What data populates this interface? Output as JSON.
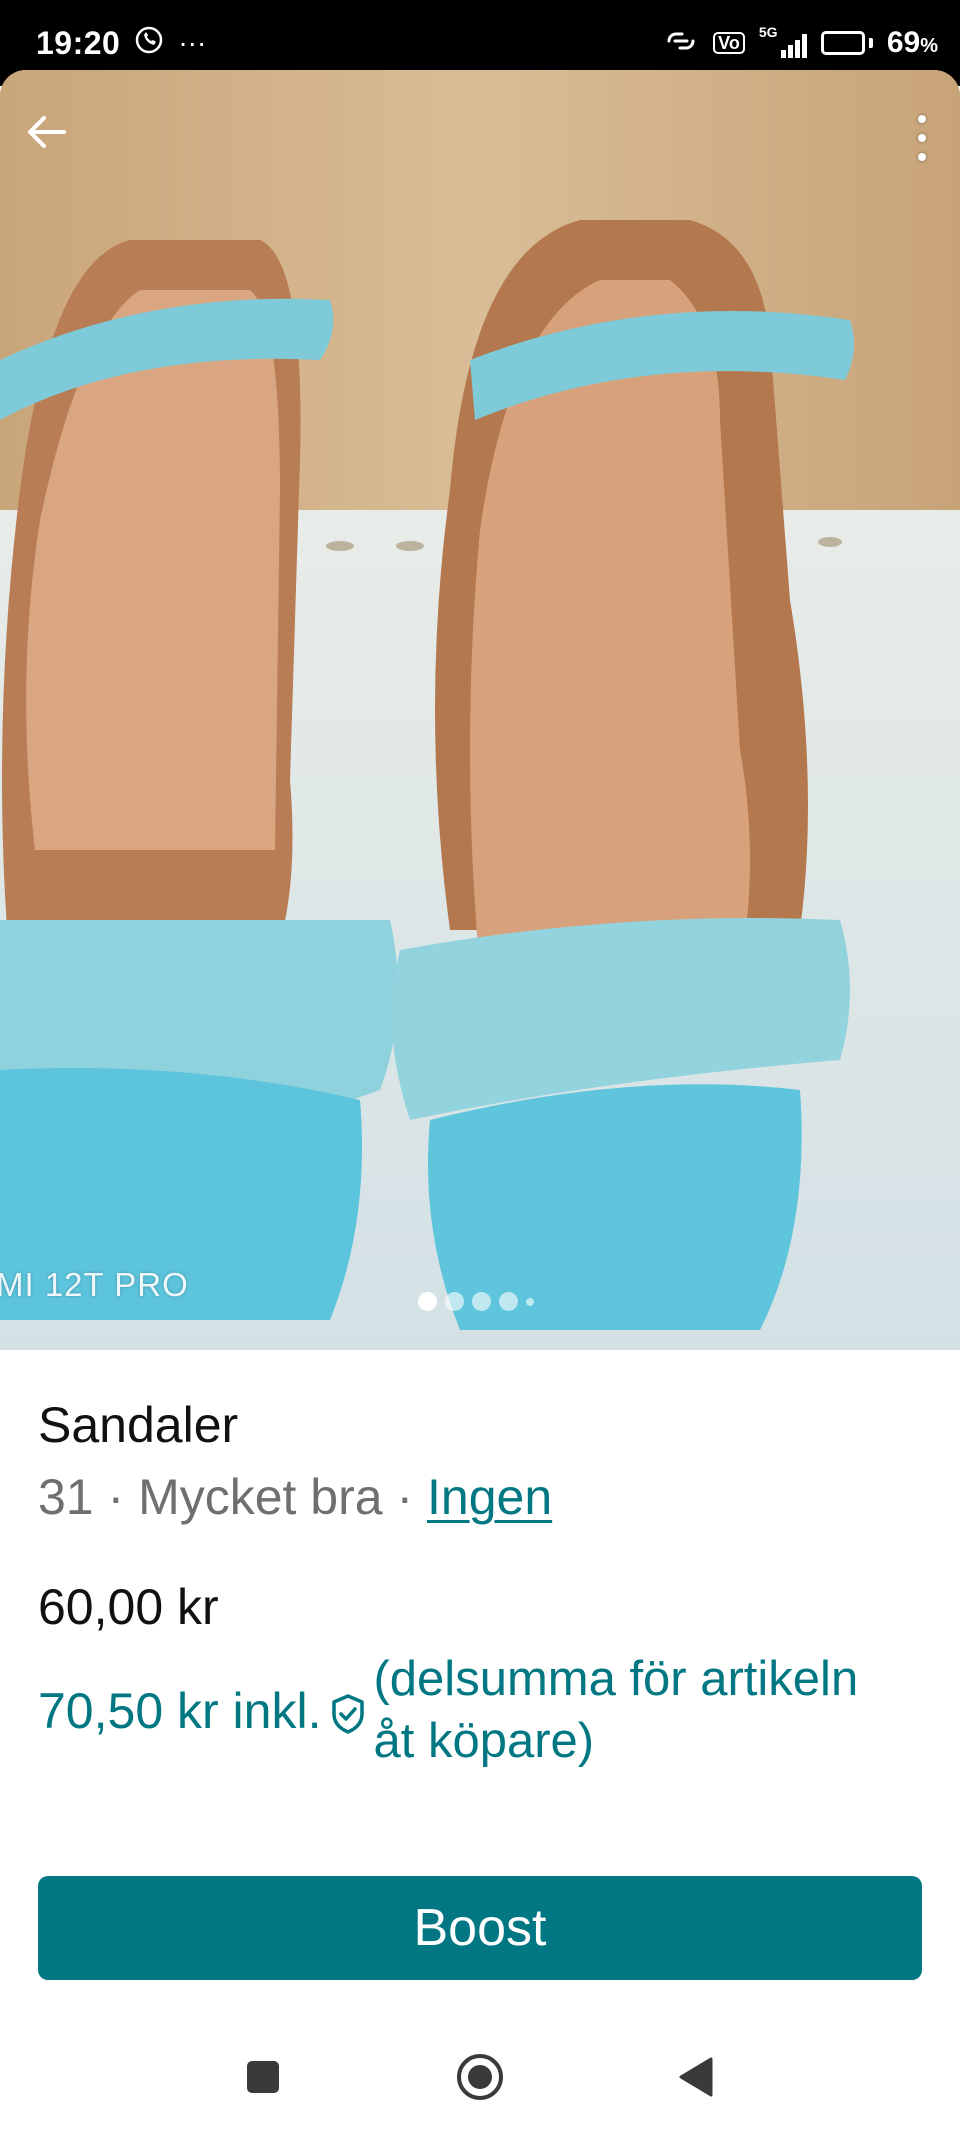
{
  "status_bar": {
    "time": "19:20",
    "app_icons": [
      "viber-icon",
      "more-dots-icon"
    ],
    "more": "···",
    "network_label": "5G",
    "volte_label": "Vo",
    "battery_level": 69,
    "battery_text": "69",
    "battery_pct_sign": "%"
  },
  "photo": {
    "watermark": "MI 12T PRO",
    "pager": {
      "count": 5,
      "active_index": 0
    }
  },
  "item": {
    "title": "Sandaler",
    "size": "31",
    "separator": " · ",
    "condition": "Mycket bra",
    "brand": "Ingen",
    "price": "60,00 kr",
    "price_incl": "70,50 kr inkl.",
    "price_note": "(delsumma för artikeln åt köpare)"
  },
  "actions": {
    "boost_label": "Boost"
  },
  "colors": {
    "accent": "#007782",
    "text_primary": "#111111",
    "text_secondary": "#6f6f6f"
  }
}
